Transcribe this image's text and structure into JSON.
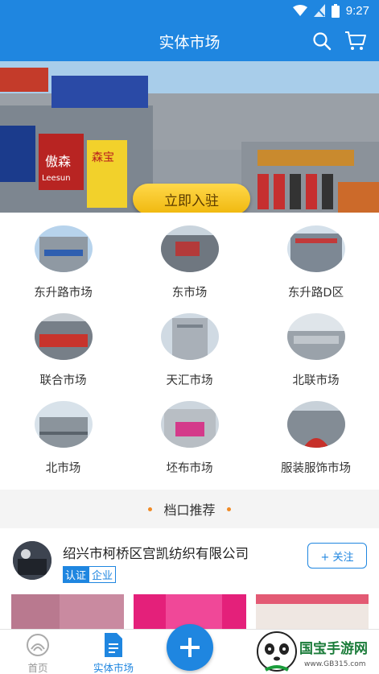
{
  "status_bar": {
    "time": "9:27"
  },
  "header": {
    "title": "实体市场",
    "search_icon": "search-icon",
    "cart_icon": "cart-icon"
  },
  "banner": {
    "join_label": "立即入驻",
    "sign_text": "傲森",
    "sign_text_2": "Leesun",
    "sign_text_3": "森宝"
  },
  "markets": [
    {
      "label": "东升路市场"
    },
    {
      "label": "东市场"
    },
    {
      "label": "东升路D区"
    },
    {
      "label": "联合市场"
    },
    {
      "label": "天汇市场"
    },
    {
      "label": "北联市场"
    },
    {
      "label": "北市场"
    },
    {
      "label": "坯布市场"
    },
    {
      "label": "服装服饰市场"
    }
  ],
  "section": {
    "title": "档口推荐"
  },
  "shop": {
    "name": "绍兴市柯桥区宫凯纺织有限公司",
    "verified_label": "认证",
    "type_label": "企业",
    "follow_label": "+ 关注"
  },
  "bottom_nav": {
    "home_label": "首页",
    "market_label": "实体市场"
  },
  "watermark": {
    "brand": "国宝手游网",
    "url": "www.GB315.com"
  },
  "colors": {
    "primary": "#1f86e0",
    "accent_dot": "#f08a24",
    "join_button": "#f5c518"
  }
}
